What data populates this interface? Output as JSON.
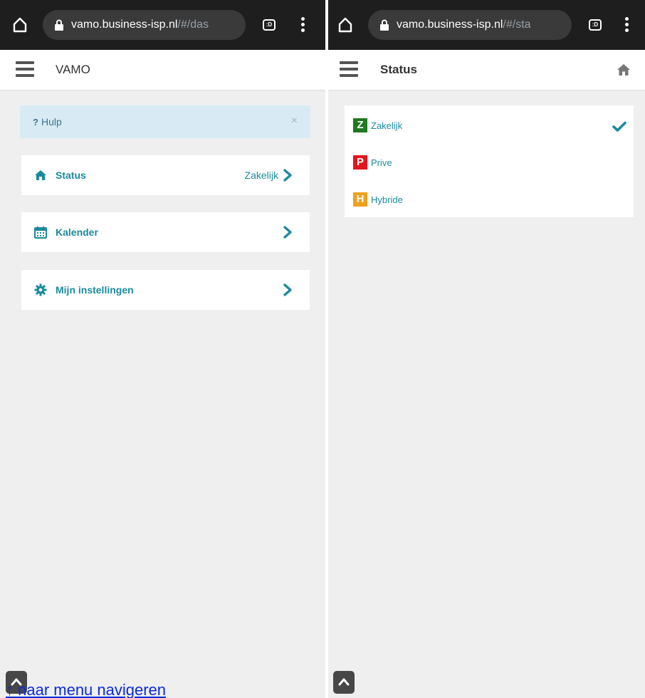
{
  "left_panel": {
    "browser": {
      "url_host": "vamo.business-isp.nl",
      "url_path": "/#/das"
    },
    "header": {
      "title": "VAMO"
    },
    "help": {
      "q": "?",
      "label": "Hulp",
      "close": "×"
    },
    "menu": [
      {
        "label": "Status",
        "value": "Zakelijk",
        "icon": "home-icon"
      },
      {
        "label": "Kalender",
        "value": "",
        "icon": "calendar-icon"
      },
      {
        "label": "Mijn instellingen",
        "value": "",
        "icon": "gear-icon"
      }
    ],
    "skip_link": "↑ naar menu navigeren"
  },
  "right_panel": {
    "browser": {
      "url_host": "vamo.business-isp.nl",
      "url_path": "/#/sta"
    },
    "header": {
      "title": "Status"
    },
    "statuses": [
      {
        "badge": "Z",
        "label": "Zakelijk",
        "color": "#1f7a1f",
        "selected": true
      },
      {
        "badge": "P",
        "label": "Prive",
        "color": "#e3151d",
        "selected": false
      },
      {
        "badge": "H",
        "label": "Hybride",
        "color": "#f0a21c",
        "selected": false
      }
    ]
  },
  "colors": {
    "accent": "#1a8a9e",
    "browser_bar": "#1e1e1e",
    "background": "#efefef"
  }
}
